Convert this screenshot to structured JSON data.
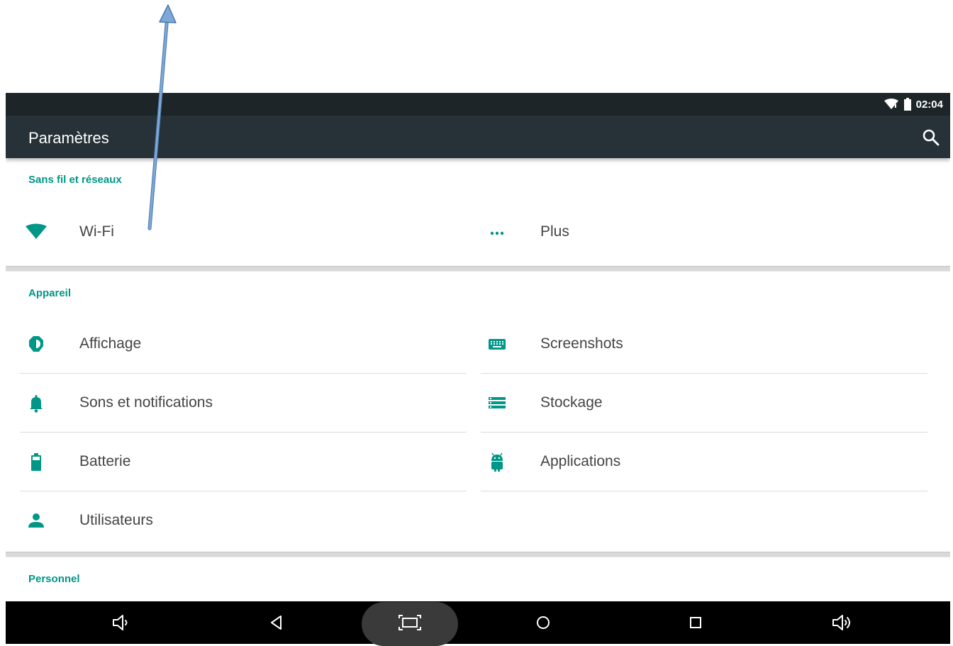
{
  "status_bar": {
    "time": "02:04",
    "icons": [
      "wifi-icon",
      "battery-icon"
    ]
  },
  "app_bar": {
    "title": "Paramètres",
    "action_icon": "search-icon"
  },
  "sections": [
    {
      "header": "Sans fil et réseaux",
      "items": [
        {
          "label": "Wi-Fi",
          "icon": "wifi-icon"
        },
        {
          "label": "Plus",
          "icon": "more-icon"
        }
      ]
    },
    {
      "header": "Appareil",
      "items": [
        {
          "label": "Affichage",
          "icon": "brightness-icon"
        },
        {
          "label": "Screenshots",
          "icon": "keyboard-icon"
        },
        {
          "label": "Sons et notifications",
          "icon": "bell-icon"
        },
        {
          "label": "Stockage",
          "icon": "storage-icon"
        },
        {
          "label": "Batterie",
          "icon": "battery-icon"
        },
        {
          "label": "Applications",
          "icon": "android-icon"
        },
        {
          "label": "Utilisateurs",
          "icon": "person-icon"
        }
      ]
    },
    {
      "header": "Personnel",
      "items": []
    }
  ],
  "nav_bar": {
    "buttons": [
      "volume-down-icon",
      "back-icon",
      "screenshot-icon",
      "home-icon",
      "recents-icon",
      "volume-up-icon"
    ]
  },
  "annotation": {
    "icon": "arrow-up-icon"
  },
  "colors": {
    "accent": "#009688",
    "appbar": "#263238",
    "statusbar": "#1e2529",
    "navbar": "#000000",
    "annotation_arrow": "#6a9bd0"
  }
}
